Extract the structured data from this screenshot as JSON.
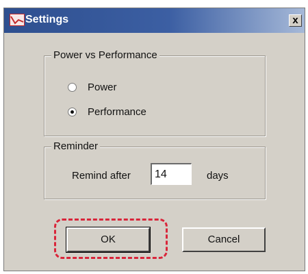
{
  "window": {
    "title": "Settings",
    "app_icon": "chart-icon",
    "close_label": "x"
  },
  "power_group": {
    "label": "Power vs Performance",
    "options": [
      {
        "label": "Power",
        "selected": false
      },
      {
        "label": "Performance",
        "selected": true
      }
    ]
  },
  "reminder_group": {
    "label": "Reminder",
    "prefix": "Remind after",
    "value": "14",
    "suffix": "days"
  },
  "buttons": {
    "ok_label": "OK",
    "cancel_label": "Cancel"
  },
  "annotation": {
    "highlight_color": "#d9253a",
    "highlighted": "ok-button"
  },
  "colors": {
    "dialog_bg": "#d4d0c8",
    "title_start": "#2e4f8f",
    "title_end": "#a6b9d8"
  }
}
